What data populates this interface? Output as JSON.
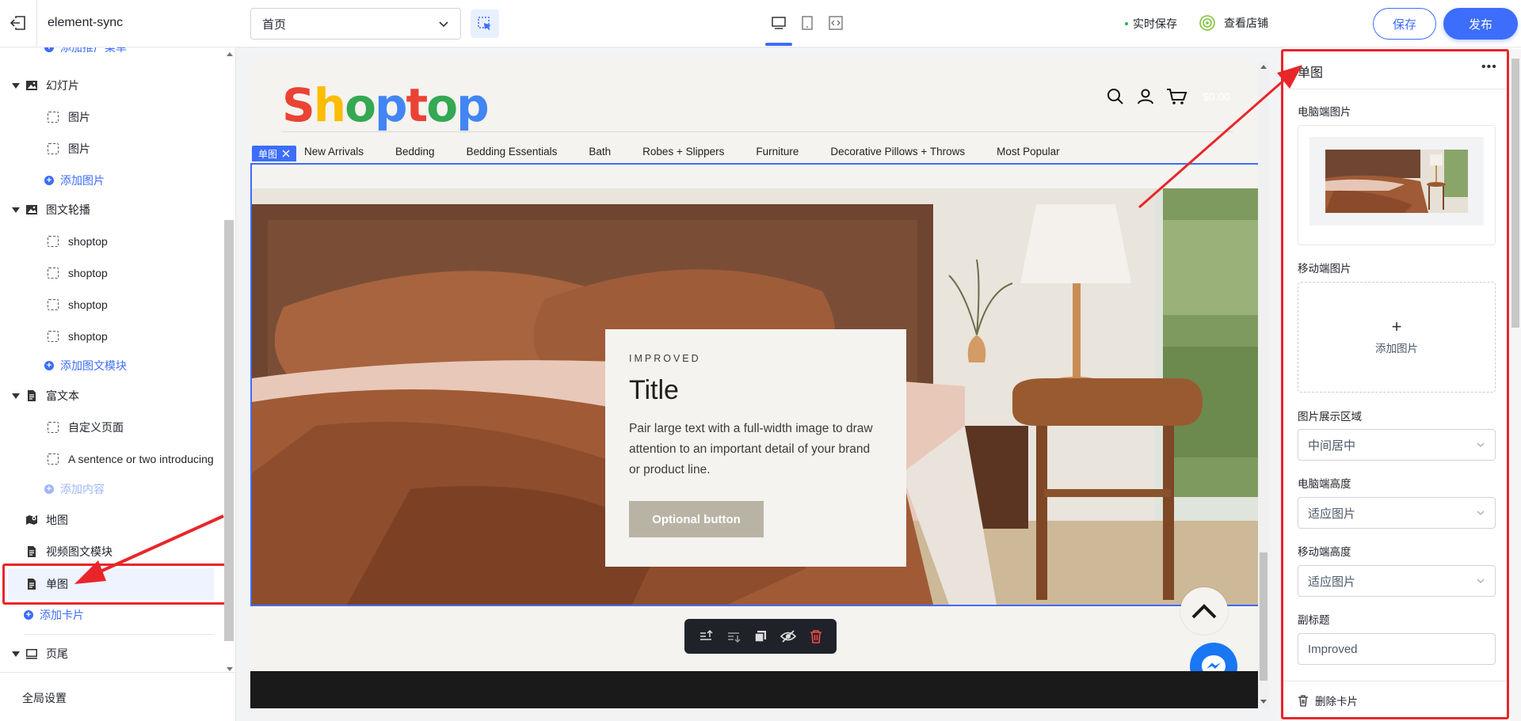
{
  "topbar": {
    "app_title": "element-sync",
    "page_select": "首页",
    "autosave": "实时保存",
    "view_store": "查看店铺",
    "save": "保存",
    "publish": "发布"
  },
  "sidebar": {
    "partial_top": "添加推广菜单",
    "slideshow": {
      "label": "幻灯片",
      "items": [
        "图片",
        "图片"
      ],
      "add": "添加图片"
    },
    "carousel": {
      "label": "图文轮播",
      "items": [
        "shoptop",
        "shoptop",
        "shoptop",
        "shoptop"
      ],
      "add": "添加图文模块"
    },
    "richtext": {
      "label": "富文本",
      "items": [
        "自定义页面",
        "A sentence or two introducing"
      ],
      "add": "添加内容"
    },
    "map": "地图",
    "video": "视频图文模块",
    "single_image": "单图",
    "add_card": "添加卡片",
    "footer": "页尾",
    "global_settings": "全局设置"
  },
  "preview": {
    "logo": "Shoptop",
    "cart_total": "$0.00",
    "block_tag": "单图",
    "nav": [
      "New Arrivals",
      "Bedding",
      "Bedding Essentials",
      "Bath",
      "Robes + Slippers",
      "Furniture",
      "Decorative Pillows + Throws",
      "Most Popular"
    ],
    "hero": {
      "subtitle": "IMPROVED",
      "title": "Title",
      "text": "Pair large text with a full-width image to draw attention to an important detail of your brand or product line.",
      "button": "Optional button"
    }
  },
  "panel": {
    "title": "单图",
    "pc_image_label": "电脑端图片",
    "mobile_image_label": "移动端图片",
    "add_image": "添加图片",
    "display_area_label": "图片展示区域",
    "display_area_value": "中间居中",
    "pc_height_label": "电脑端高度",
    "pc_height_value": "适应图片",
    "mobile_height_label": "移动端高度",
    "mobile_height_value": "适应图片",
    "subtitle_label": "副标题",
    "subtitle_value": "Improved",
    "delete_card": "删除卡片"
  },
  "colors": {
    "accent": "#3d6dfb",
    "annotation_red": "#e8262a",
    "toolbar_dark": "#1f2329",
    "hero_button": "#b9b3a6",
    "messenger": "#1977f3"
  },
  "icons": [
    "exit-icon",
    "chevron-down-icon",
    "select-element-icon",
    "desktop-icon",
    "tablet-icon",
    "code-icon",
    "store-icon",
    "image-icon",
    "page-icon",
    "map-icon",
    "search-icon",
    "user-icon",
    "cart-icon",
    "chevron-up-icon",
    "messenger-icon",
    "more-icon",
    "trash-icon"
  ]
}
